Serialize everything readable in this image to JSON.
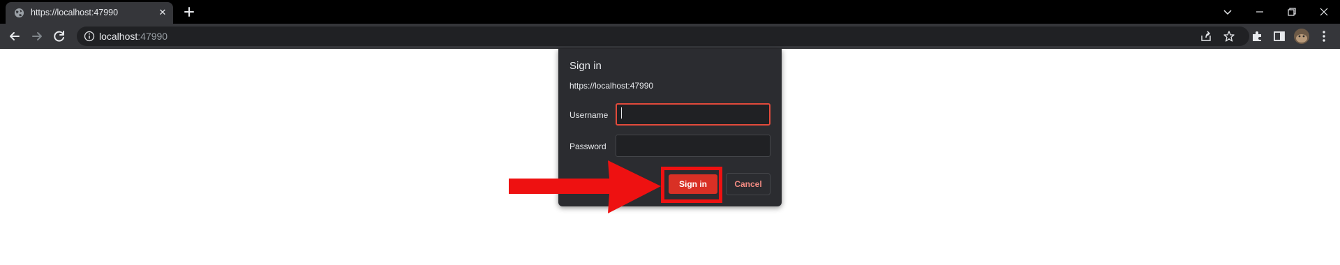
{
  "browser": {
    "tab": {
      "title": "https://localhost:47990",
      "close_glyph": "✕",
      "favicon": "globe-icon"
    },
    "address_bar": {
      "host": "localhost",
      "port": ":47990",
      "info_icon": "info-icon"
    },
    "colors": {
      "tabstrip_bg": "#000000",
      "toolbar_bg": "#35363a",
      "omnibox_bg": "#202124",
      "accent_red": "#d93025"
    }
  },
  "dialog": {
    "title": "Sign in",
    "origin": "https://localhost:47990",
    "username_label": "Username",
    "username_value": "",
    "password_label": "Password",
    "password_value": "",
    "signin_label": "Sign in",
    "cancel_label": "Cancel"
  },
  "annotation": {
    "arrow_color": "#ee1111",
    "target": "signin-button"
  }
}
